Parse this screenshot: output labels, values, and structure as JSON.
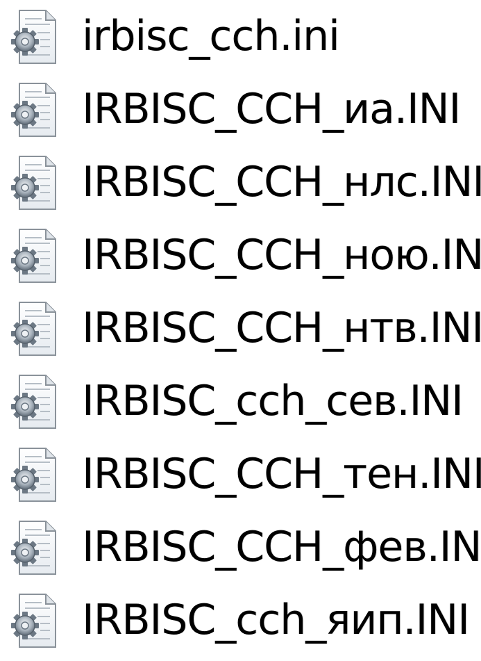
{
  "file_icon": "ini-config-file-icon",
  "files": [
    {
      "name": "irbisc_cch.ini"
    },
    {
      "name": "IRBISC_CCH_иа.INI"
    },
    {
      "name": "IRBISC_CCH_нлс.INI"
    },
    {
      "name": "IRBISC_CCH_ною.INI"
    },
    {
      "name": "IRBISC_CCH_нтв.INI"
    },
    {
      "name": "IRBISC_cch_сев.INI"
    },
    {
      "name": "IRBISC_CCH_тен.INI"
    },
    {
      "name": "IRBISC_CCH_фев.INI"
    },
    {
      "name": "IRBISC_cch_яип.INI"
    }
  ]
}
